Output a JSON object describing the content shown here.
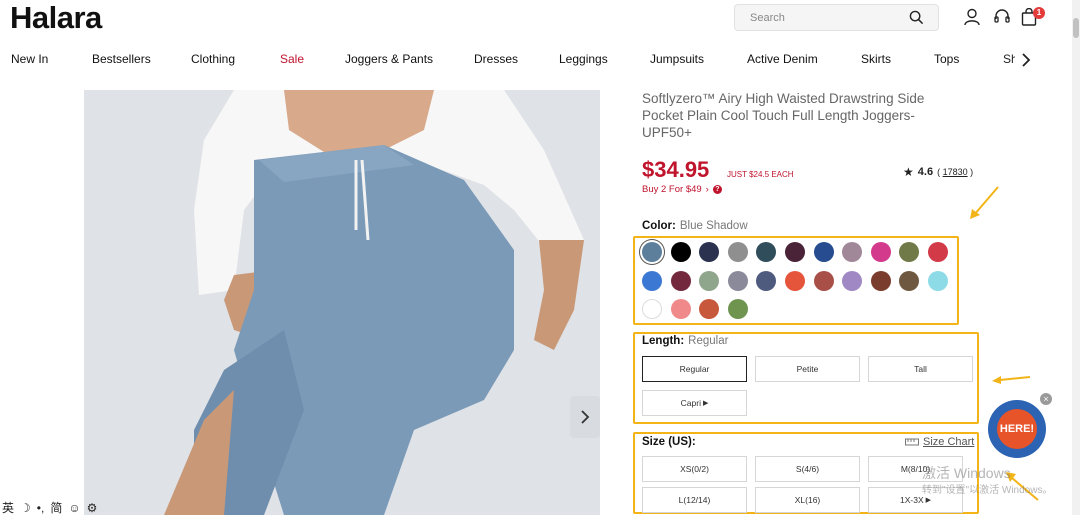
{
  "brand": {
    "logo": "Halara"
  },
  "search": {
    "placeholder": "Search"
  },
  "header": {
    "cart_count": "1"
  },
  "nav": {
    "items": [
      "New In",
      "Bestsellers",
      "Clothing",
      "Sale",
      "Joggers & Pants",
      "Dresses",
      "Leggings",
      "Jumpsuits",
      "Active Denim",
      "Skirts",
      "Tops"
    ],
    "clipped": "Sh"
  },
  "product": {
    "title": "Softlyzero™ Airy High Waisted Drawstring Side Pocket Plain Cool Touch Full Length Joggers-UPF50+",
    "price": "$34.95",
    "each_note": "JUST $24.5 EACH",
    "promo": "Buy 2 For $49",
    "rating": "4.6",
    "reviews": "17830"
  },
  "color": {
    "label": "Color:",
    "selected": "Blue Shadow",
    "swatches": [
      "#5d7f9c",
      "#000000",
      "#2a3250",
      "#8f8f8f",
      "#2f4d5a",
      "#4b2338",
      "#274c8f",
      "#a08898",
      "#d43a8c",
      "#6f7a48",
      "#d23a48",
      "#3b78d4",
      "#74283d",
      "#8fa58c",
      "#8a8a9a",
      "#4e5a7e",
      "#e4553c",
      "#a85048",
      "#a088c4",
      "#7a3c2c",
      "#6e5840",
      "#8cdbe6",
      "#ffffff",
      "#f08a8a",
      "#c8583c",
      "#6e9450"
    ]
  },
  "length": {
    "label": "Length:",
    "selected": "Regular",
    "options": [
      "Regular",
      "Petite",
      "Tall",
      "Capri"
    ]
  },
  "size": {
    "label": "Size (US):",
    "chart_link": "Size Chart",
    "options": [
      "XS(0/2)",
      "S(4/6)",
      "M(8/10)",
      "L(12/14)",
      "XL(16)",
      "1X-3X"
    ]
  },
  "promo_badge": {
    "text": "HERE!"
  },
  "watermark": {
    "line1": "激活 Windows",
    "line2": "转到\"设置\"以激活 Windows。"
  },
  "ime": {
    "items": [
      "英",
      "☽",
      "•,",
      "简",
      "☺",
      "⚙"
    ]
  }
}
